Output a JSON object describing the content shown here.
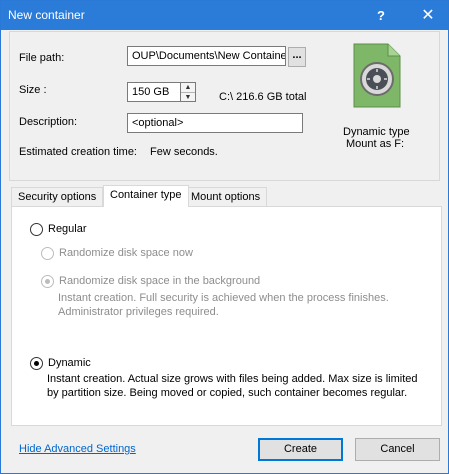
{
  "window": {
    "title": "New container",
    "help": "?",
    "close": "✕"
  },
  "form": {
    "file_path_label": "File path:",
    "file_path_value": "OUP\\Documents\\New Container",
    "browse_label": "...",
    "size_label": "Size :",
    "size_value": "150 GB",
    "drive_info": "C:\\ 216.6 GB total",
    "description_label": "Description:",
    "description_value": "<optional>",
    "estimate_label": "Estimated creation time:",
    "estimate_value": "Few seconds."
  },
  "container_info": {
    "line1": "Dynamic type",
    "line2": "Mount as F:",
    "icon": "safe-icon"
  },
  "tabs": [
    {
      "label": "Security options"
    },
    {
      "label": "Container type"
    },
    {
      "label": "Mount options"
    }
  ],
  "container_type": {
    "regular_label": "Regular",
    "randomize_now_label": "Randomize disk space now",
    "randomize_bg_label": "Randomize disk space in the background",
    "randomize_bg_desc1": "Instant creation. Full security is achieved when the process finishes.",
    "randomize_bg_desc2": "Administrator privileges required.",
    "dynamic_label": "Dynamic",
    "dynamic_desc1": "Instant creation. Actual size grows with files being added. Max size is limited",
    "dynamic_desc2": "by partition size. Being moved or copied, such container becomes regular.",
    "selected": "Dynamic"
  },
  "footer": {
    "advanced_link": "Hide Advanced Settings",
    "create_label": "Create",
    "cancel_label": "Cancel"
  }
}
